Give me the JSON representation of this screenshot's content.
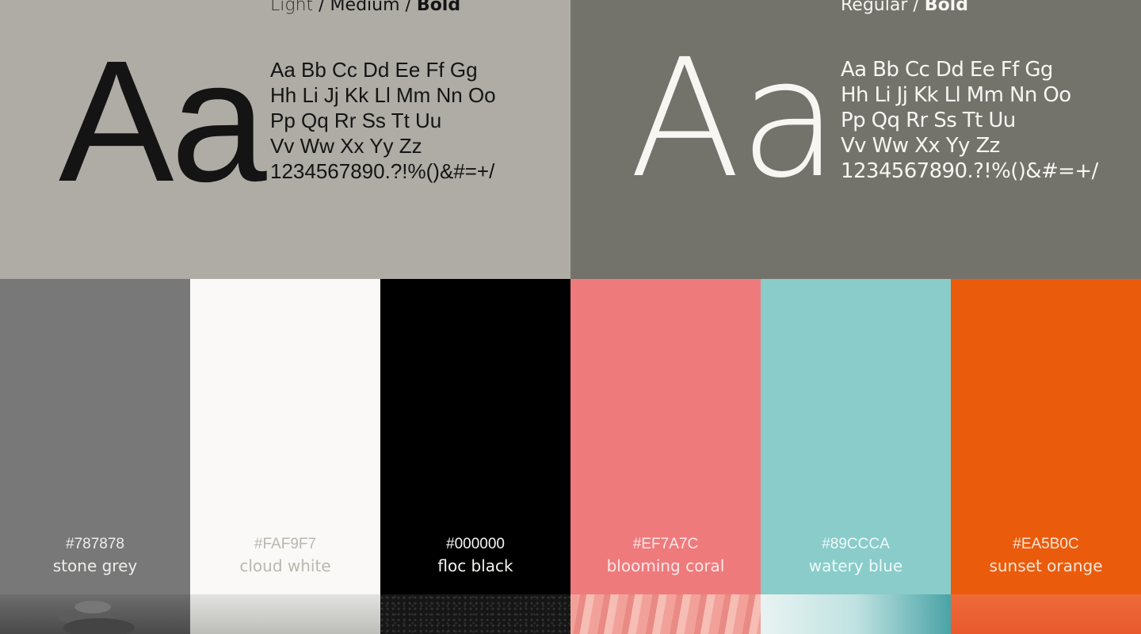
{
  "primary_font": {
    "weights": {
      "light": "Light",
      "sep1": " / ",
      "medium": "Medium",
      "sep2": " / ",
      "bold": "Bold"
    },
    "sample": "Aa",
    "glyph_lines": [
      "Aa Bb Cc Dd Ee Ff Gg",
      "Hh Li Jj Kk Ll Mm Nn Oo",
      "Pp Qq Rr Ss Tt Uu",
      "Vv Ww Xx Yy Zz",
      "1234567890.?!%()&#=+/"
    ]
  },
  "secondary_font": {
    "weights": {
      "regular": "Regular",
      "sep1": " / ",
      "bold": "Bold"
    },
    "sample": "Aa",
    "glyph_lines": [
      "Aa Bb Cc Dd Ee Ff Gg",
      "Hh Li Jj Kk Ll Mm Nn Oo",
      "Pp Qq Rr Ss Tt Uu",
      "Vv Ww Xx Yy Zz",
      "1234567890.?!%()&#=+/"
    ]
  },
  "palette": [
    {
      "hex": "#787878",
      "name": "stone grey",
      "color": "#787878",
      "photo": "stacked-stones-photo"
    },
    {
      "hex": "#FAF9F7",
      "name": "cloud white",
      "color": "#FAF9F7",
      "photo": "clouds-photo"
    },
    {
      "hex": "#000000",
      "name": "floc black",
      "color": "#000000",
      "photo": "dark-texture-photo"
    },
    {
      "hex": "#EF7A7C",
      "name": "blooming coral",
      "color": "#EF7A7C",
      "photo": "petals-photo"
    },
    {
      "hex": "#89CCCA",
      "name": "watery blue",
      "color": "#89CCCA",
      "photo": "water-splash-photo"
    },
    {
      "hex": "#EA5B0C",
      "name": "sunset orange",
      "color": "#EA5B0C",
      "photo": "sunset-photo"
    }
  ]
}
